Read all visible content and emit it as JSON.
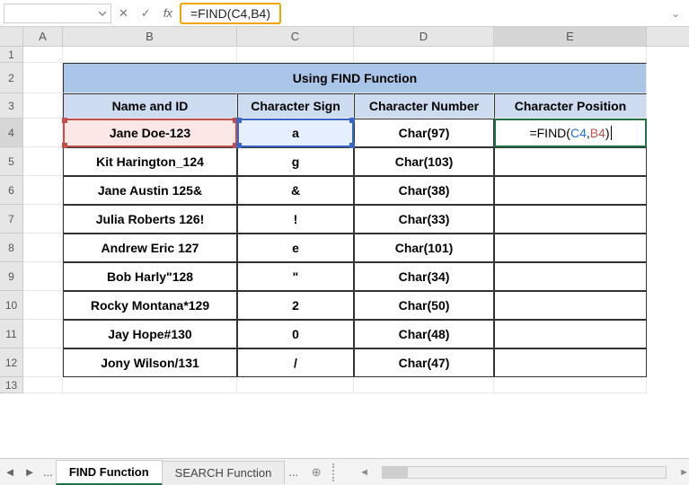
{
  "formula_bar": {
    "cancel_icon": "✕",
    "enter_icon": "✓",
    "fx_label": "fx",
    "formula_display": "=FIND(C4,B4)"
  },
  "columns": [
    "A",
    "B",
    "C",
    "D",
    "E"
  ],
  "row_numbers": [
    "1",
    "2",
    "3",
    "4",
    "5",
    "6",
    "7",
    "8",
    "9",
    "10",
    "11",
    "12",
    "13"
  ],
  "title": "Using FIND Function",
  "headers": {
    "b": "Name and ID",
    "c": "Character Sign",
    "d": "Character Number",
    "e": "Character Position"
  },
  "active_formula": {
    "prefix": "=FIND(",
    "ref1": "C4",
    "comma": ",",
    "ref2": "B4",
    "suffix": ")"
  },
  "chart_data": {
    "type": "table",
    "columns": [
      "Name and ID",
      "Character Sign",
      "Character Number",
      "Character Position"
    ],
    "rows": [
      {
        "name": "Jane Doe-123",
        "sign": "a",
        "num": "Char(97)",
        "pos": "=FIND(C4,B4)"
      },
      {
        "name": "Kit Harington_124",
        "sign": "g",
        "num": "Char(103)",
        "pos": ""
      },
      {
        "name": "Jane Austin 125&",
        "sign": "&",
        "num": "Char(38)",
        "pos": ""
      },
      {
        "name": "Julia Roberts 126!",
        "sign": "!",
        "num": "Char(33)",
        "pos": ""
      },
      {
        "name": "Andrew Eric 127",
        "sign": "e",
        "num": "Char(101)",
        "pos": ""
      },
      {
        "name": "Bob Harly\"128",
        "sign": "\"",
        "num": "Char(34)",
        "pos": ""
      },
      {
        "name": "Rocky Montana*129",
        "sign": "2",
        "num": "Char(50)",
        "pos": ""
      },
      {
        "name": "Jay Hope#130",
        "sign": "0",
        "num": "Char(48)",
        "pos": ""
      },
      {
        "name": "Jony Wilson/131",
        "sign": "/",
        "num": "Char(47)",
        "pos": ""
      }
    ]
  },
  "tabs": {
    "active": "FIND Function",
    "inactive": "SEARCH Function",
    "ellipsis": "..."
  }
}
